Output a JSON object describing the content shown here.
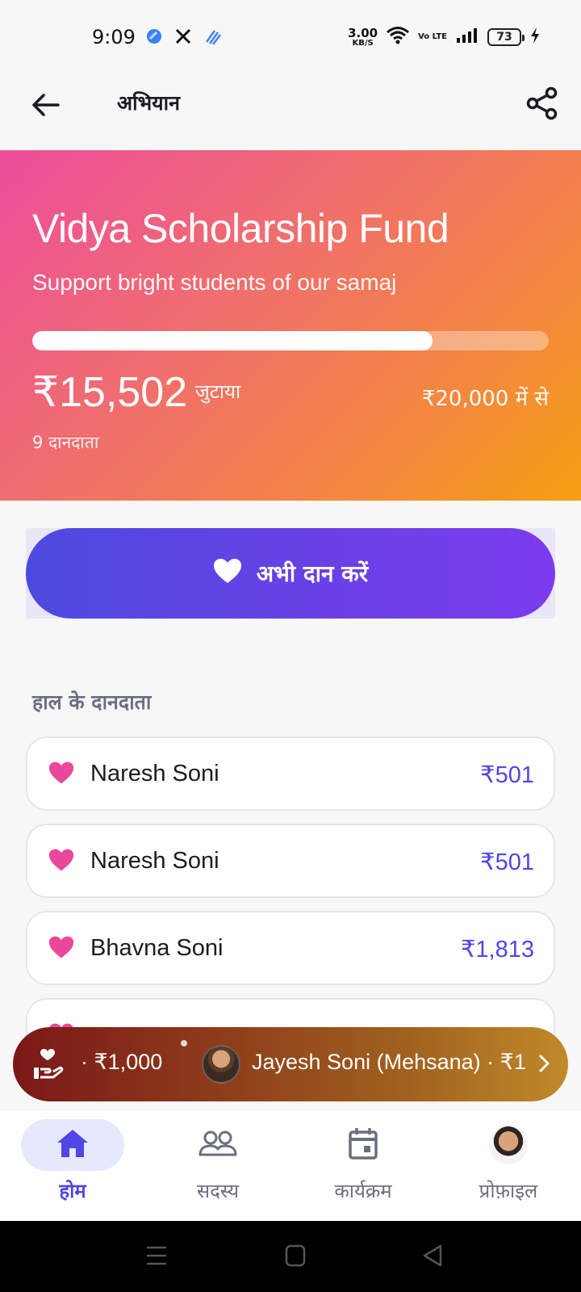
{
  "status_bar": {
    "time": "9:09",
    "net_speed_value": "3.00",
    "net_speed_unit": "KB/S",
    "volte": "Vo LTE",
    "battery": "73"
  },
  "app_bar": {
    "title": "अभियान",
    "back_icon": "arrow-left-icon",
    "share_icon": "share-icon"
  },
  "campaign": {
    "title": "Vidya Scholarship Fund",
    "subtitle": "Support bright students of our samaj",
    "raised": "₹15,502",
    "raised_label": "जुटाया",
    "goal_label": "₹20,000 में से",
    "donor_count": "9 दानदाता",
    "progress_fraction": 0.775,
    "gradient_colors": [
      "#ec4d9c",
      "#f3883e",
      "#f5a012"
    ]
  },
  "donate_button": {
    "label": "अभी दान करें",
    "icon": "heart-icon"
  },
  "recent_donors": {
    "title": "हाल के दानदाता",
    "items": [
      {
        "name": "Naresh Soni",
        "amount": "₹501"
      },
      {
        "name": "Naresh Soni",
        "amount": "₹501"
      },
      {
        "name": "Bhavna Soni",
        "amount": "₹1,813"
      }
    ]
  },
  "ticker": {
    "prev_amount": "· ₹1,000",
    "current_text": "Jayesh Soni (Mehsana) · ₹1,",
    "icon": "donation-hand-icon"
  },
  "bottom_nav": {
    "items": [
      {
        "label": "होम",
        "icon": "home-icon",
        "active": true
      },
      {
        "label": "सदस्य",
        "icon": "members-icon",
        "active": false
      },
      {
        "label": "कार्यक्रम",
        "icon": "calendar-icon",
        "active": false
      },
      {
        "label": "प्रोफ़ाइल",
        "icon": "profile-avatar",
        "active": false
      }
    ]
  },
  "colors": {
    "accent": "#4f46e5",
    "heart": "#ec4899",
    "text_dark": "#1c1b24",
    "muted": "#6a6f80"
  }
}
